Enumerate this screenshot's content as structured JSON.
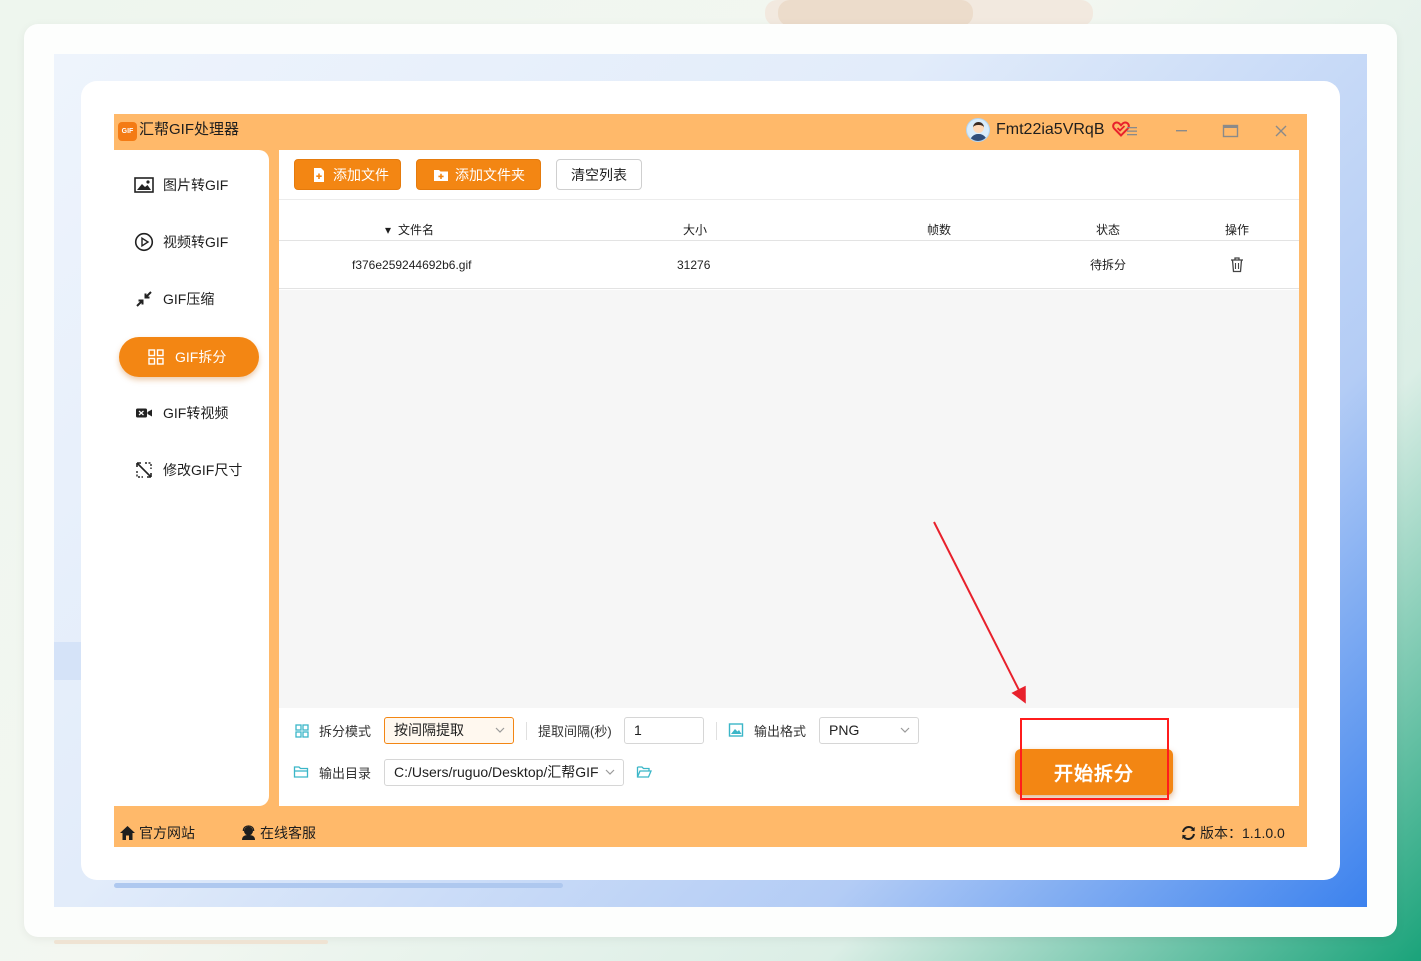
{
  "app": {
    "title": "汇帮GIF处理器",
    "logo_text": "GIF",
    "username": "Fmt22ia5VRqB"
  },
  "sidebar": {
    "items": [
      {
        "label": "图片转GIF",
        "icon": "image-icon",
        "active": false
      },
      {
        "label": "视频转GIF",
        "icon": "play-circle-icon",
        "active": false
      },
      {
        "label": "GIF压缩",
        "icon": "compress-icon",
        "active": false
      },
      {
        "label": "GIF拆分",
        "icon": "grid-split-icon",
        "active": true
      },
      {
        "label": "GIF转视频",
        "icon": "video-camera-icon",
        "active": false
      },
      {
        "label": "修改GIF尺寸",
        "icon": "resize-icon",
        "active": false
      }
    ]
  },
  "toolbar": {
    "add_file": "添加文件",
    "add_folder": "添加文件夹",
    "clear_list": "清空列表"
  },
  "table": {
    "columns": [
      "文件名",
      "大小",
      "帧数",
      "状态",
      "操作"
    ],
    "rows": [
      {
        "filename": "f376e259244692b6.gif",
        "size": "31276",
        "frames": "",
        "status": "待拆分"
      }
    ]
  },
  "settings": {
    "split_mode_label": "拆分模式",
    "split_mode_value": "按间隔提取",
    "interval_label": "提取间隔(秒)",
    "interval_value": "1",
    "format_label": "输出格式",
    "format_value": "PNG",
    "output_dir_label": "输出目录",
    "output_dir_value": "C:/Users/ruguo/Desktop/汇帮GIF"
  },
  "start_button": "开始拆分",
  "footer": {
    "website": "官方网站",
    "support": "在线客服",
    "version": "版本：1.1.0.0"
  },
  "colors": {
    "accent": "#f38613",
    "frame": "#ffb96a",
    "annotation": "#ff1c1c"
  }
}
